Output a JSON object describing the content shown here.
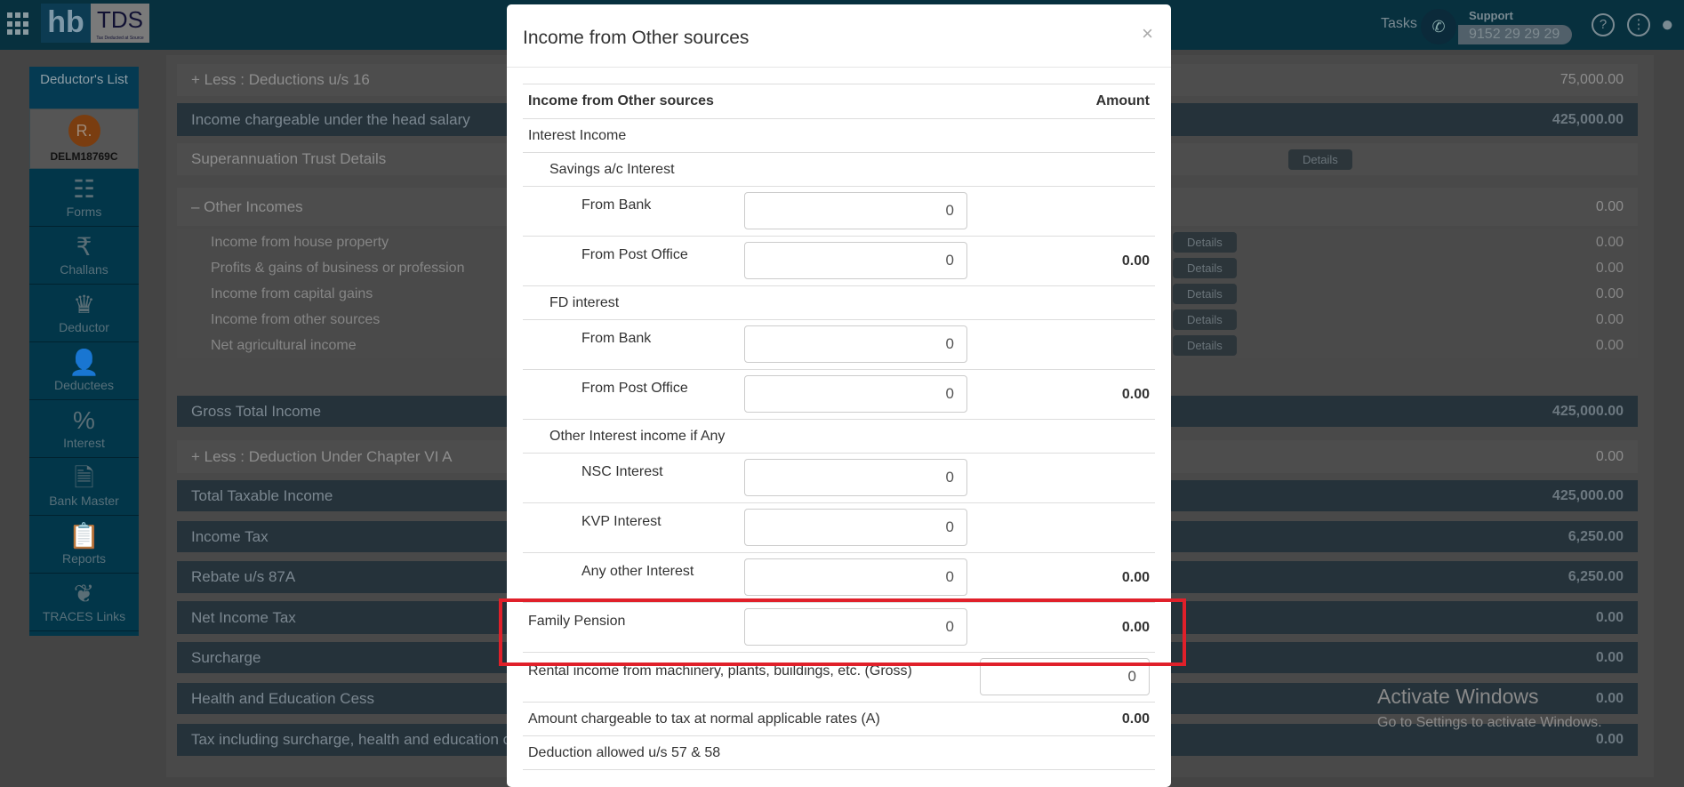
{
  "topbar": {
    "logo_hb": "hb",
    "logo_tds": "TDS",
    "logo_tagline": "Tax Deducted at Source",
    "tasks": "Tasks",
    "support_label": "Support",
    "support_phone": "9152 29 29 29",
    "help_icon": "?",
    "more_icon": "⋮"
  },
  "sidebar": {
    "header": "Deductor's List",
    "avatar_initial": "R.",
    "deductor_code": "DELM18769C",
    "items": [
      {
        "label": "Forms",
        "icon": "forms-icon",
        "glyph": "☷"
      },
      {
        "label": "Challans",
        "icon": "challan-icon",
        "glyph": "₹"
      },
      {
        "label": "Deductor",
        "icon": "crown-icon",
        "glyph": "♛"
      },
      {
        "label": "Deductees",
        "icon": "person-icon",
        "glyph": "👤"
      },
      {
        "label": "Interest",
        "icon": "money-bag-icon",
        "glyph": "%"
      },
      {
        "label": "Bank Master",
        "icon": "bank-document-icon",
        "glyph": "🗎"
      },
      {
        "label": "Reports",
        "icon": "clipboard-chart-icon",
        "glyph": "📋"
      },
      {
        "label": "TRACES Links",
        "icon": "traces-icon",
        "glyph": "❦"
      }
    ]
  },
  "background_rows": [
    {
      "label": "+ Less : Deductions u/s 16",
      "value": "75,000.00",
      "style": "normal"
    },
    {
      "label": "Income chargeable under the head salary",
      "value": "425,000.00",
      "style": "dark"
    },
    {
      "label": "Superannuation Trust Details",
      "value": "",
      "style": "normal",
      "button": "Details"
    },
    {
      "label": "– Other Incomes",
      "value": "0.00",
      "style": "normal"
    },
    {
      "label": "Income from house property",
      "value": "0.00",
      "style": "sub",
      "button": "Details"
    },
    {
      "label": "Profits & gains of business or profession",
      "value": "0.00",
      "style": "sub",
      "button": "Details"
    },
    {
      "label": "Income from capital gains",
      "value": "0.00",
      "style": "sub",
      "button": "Details"
    },
    {
      "label": "Income from other sources",
      "value": "0.00",
      "style": "sub",
      "button": "Details"
    },
    {
      "label": "Net agricultural income",
      "value": "0.00",
      "style": "sub",
      "button": "Details"
    },
    {
      "label": "Gross Total Income",
      "value": "425,000.00",
      "style": "dark"
    },
    {
      "label": "+ Less : Deduction Under Chapter VI A",
      "value": "0.00",
      "style": "normal"
    },
    {
      "label": "Total Taxable Income",
      "value": "425,000.00",
      "style": "dark"
    },
    {
      "label": "Income Tax",
      "value": "6,250.00",
      "style": "dark"
    },
    {
      "label": "Rebate u/s 87A",
      "value": "6,250.00",
      "style": "dark"
    },
    {
      "label": "Net Income Tax",
      "value": "0.00",
      "style": "dark"
    },
    {
      "label": "Surcharge",
      "value": "0.00",
      "style": "dark"
    },
    {
      "label": "Health and Education Cess",
      "value": "0.00",
      "style": "dark"
    },
    {
      "label": "Tax including surcharge, health and education cess",
      "value": "0.00",
      "style": "dark"
    }
  ],
  "modal": {
    "title": "Income from Other sources",
    "close": "×",
    "header": {
      "label": "Income from Other sources",
      "amount": "Amount"
    },
    "rows": [
      {
        "label": "Interest Income",
        "level": 0,
        "type": "section"
      },
      {
        "label": "Savings a/c Interest",
        "level": 1,
        "type": "section"
      },
      {
        "label": "From Bank",
        "level": 2,
        "type": "input",
        "value": "0"
      },
      {
        "label": "From Post Office",
        "level": 2,
        "type": "input",
        "value": "0",
        "amount": "0.00"
      },
      {
        "label": "FD interest",
        "level": 1,
        "type": "section"
      },
      {
        "label": "From Bank",
        "level": 2,
        "type": "input",
        "value": "0"
      },
      {
        "label": "From Post Office",
        "level": 2,
        "type": "input",
        "value": "0",
        "amount": "0.00"
      },
      {
        "label": "Other Interest income if Any",
        "level": 1,
        "type": "section"
      },
      {
        "label": "NSC Interest",
        "level": 2,
        "type": "input",
        "value": "0"
      },
      {
        "label": "KVP Interest",
        "level": 2,
        "type": "input",
        "value": "0"
      },
      {
        "label": "Any other Interest",
        "level": 2,
        "type": "input",
        "value": "0",
        "amount": "0.00"
      },
      {
        "label": "Family Pension",
        "level": 0,
        "type": "input",
        "value": "0",
        "amount": "0.00",
        "highlighted": true
      },
      {
        "label": "Rental income from machinery, plants, buildings, etc. (Gross)",
        "level": 0,
        "type": "input-right",
        "value": "0"
      },
      {
        "label": "Amount chargeable to tax at normal applicable rates (A)",
        "level": 0,
        "type": "section",
        "amount": "0.00"
      },
      {
        "label": "Deduction allowed u/s 57 & 58",
        "level": 0,
        "type": "section"
      }
    ]
  },
  "highlight_color": "#e0202a",
  "watermark": {
    "line1": "Activate Windows",
    "line2": "Go to Settings to activate Windows."
  }
}
